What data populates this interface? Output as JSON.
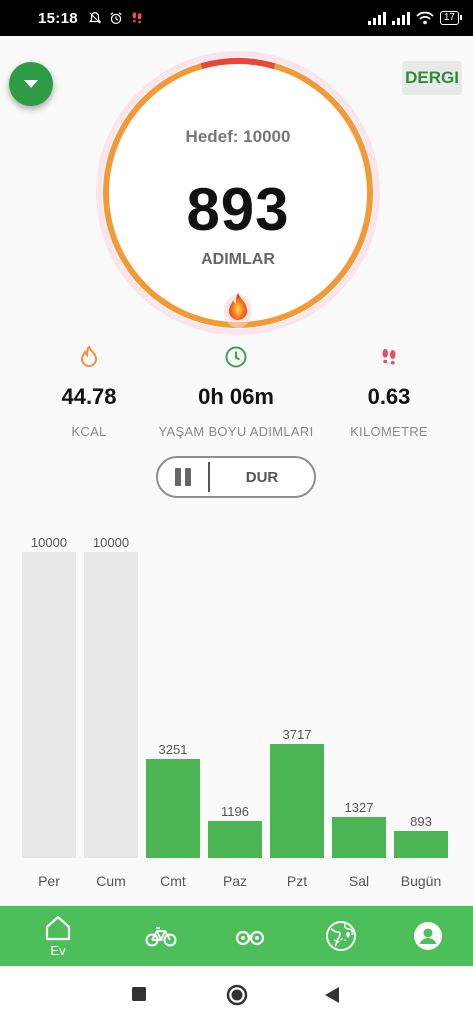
{
  "status_bar": {
    "time": "15:18",
    "battery": "17",
    "left_icons": [
      "notifications-off-icon",
      "alarm-icon",
      "footprints-icon"
    ],
    "right_icons": [
      "signal-icon",
      "signal-icon",
      "wifi-icon",
      "battery-icon"
    ]
  },
  "header": {
    "dergi_label": "DERGI"
  },
  "ring": {
    "goal_text": "Hedef: 10000",
    "steps": "893",
    "steps_label": "ADIMLAR",
    "progress_fraction": 0.0893,
    "colors": {
      "track": "#f29a38",
      "progress": "#e8463a",
      "halo": "#f8d5e1"
    }
  },
  "stats": [
    {
      "icon": "flame-icon",
      "value": "44.78",
      "label": "KCAL",
      "color": "#f0923a"
    },
    {
      "icon": "clock-icon",
      "value": "0h 06m",
      "label": "YAŞAM BOYU ADIMLARI",
      "color": "#3aa64a"
    },
    {
      "icon": "footprints-icon",
      "value": "0.63",
      "label": "KILOMETRE",
      "color": "#e4505c"
    }
  ],
  "controls": {
    "stop_label": "DUR"
  },
  "chart_data": {
    "type": "bar",
    "categories": [
      "Per",
      "Cum",
      "Cmt",
      "Paz",
      "Pzt",
      "Sal",
      "Bugün"
    ],
    "values": [
      10000,
      10000,
      3251,
      1196,
      3717,
      1327,
      893
    ],
    "value_labels": [
      "10000",
      "10000",
      "3251",
      "1196",
      "3717",
      "1327",
      "893"
    ],
    "goal_reached": [
      true,
      true,
      false,
      false,
      false,
      false,
      false
    ],
    "ylim": [
      0,
      10000
    ],
    "colors": {
      "goal_bar": "#e6e7e6",
      "bar": "#4cb553"
    }
  },
  "bottom_nav": {
    "items": [
      {
        "icon": "home-icon",
        "label": "Ev"
      },
      {
        "icon": "bicycle-icon"
      },
      {
        "icon": "binoculars-icon"
      },
      {
        "icon": "map-globe-icon"
      },
      {
        "icon": "profile-icon"
      }
    ],
    "color": "#4cbf5a"
  }
}
